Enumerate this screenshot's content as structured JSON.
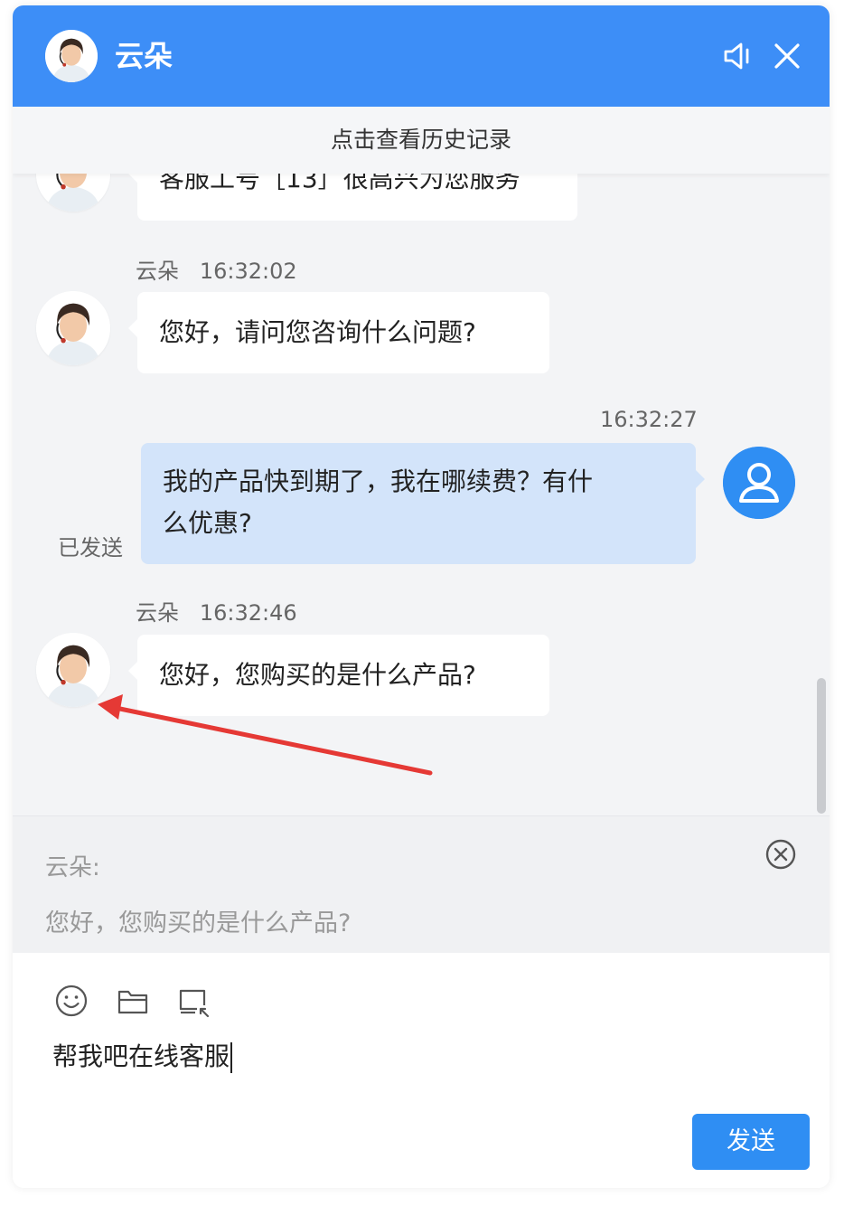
{
  "header": {
    "title": "云朵",
    "icons": [
      "sound-icon",
      "close-icon"
    ],
    "color": "#3d8ef7"
  },
  "history": {
    "label": "点击查看历史记录"
  },
  "messages": [
    {
      "from": "agent",
      "text": "客服工号［13］很高兴为您服务",
      "partial": true
    },
    {
      "from": "agent",
      "sender": "云朵",
      "time": "16:32:02",
      "text": "您好，请问您咨询什么问题?"
    },
    {
      "from": "user",
      "time": "16:32:27",
      "lines": [
        "我的产品快到期了，我在哪续费？有什",
        "么优惠?"
      ],
      "status": "已发送"
    },
    {
      "from": "agent",
      "sender": "云朵",
      "time": "16:32:46",
      "text": "您好，您购买的是什么产品?"
    }
  ],
  "quote": {
    "sender": "云朵:",
    "text": "您好，您购买的是什么产品?"
  },
  "composer": {
    "tools": [
      "emoji-icon",
      "folder-icon",
      "screenshot-icon"
    ],
    "input_value": "帮我吧在线客服",
    "send_label": "发送"
  },
  "colors": {
    "accent": "#2f8ef3",
    "user_bubble": "#d3e4fa",
    "annotation": "#e53935"
  }
}
